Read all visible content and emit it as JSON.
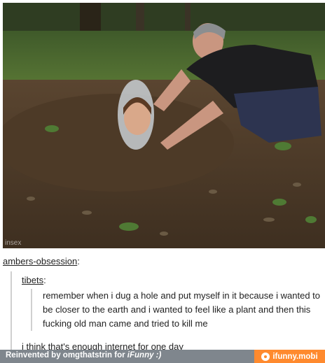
{
  "photo": {
    "description_icon": "photo-man-with-head-in-ground",
    "watermark": "insex"
  },
  "post": {
    "blog_name": "ambers-obsession",
    "blog_suffix": ":",
    "quoted_user": "tibets",
    "quoted_suffix": ":",
    "quote_lines": [
      "remember when i dug a hole and put myself in it because i wanted to",
      "be closer to the earth and i wanted to feel like a plant and then this",
      "fucking old man came and tried to kill me"
    ],
    "reply": "i think that's enough internet for one day"
  },
  "footer": {
    "reinvented_text": "Reinvented by omgthatstrin for ",
    "brand": "iFunny :)",
    "site": "ifunny.mobi",
    "colors": {
      "bar": "#7f868d",
      "accent": "#ff8a2e"
    }
  }
}
